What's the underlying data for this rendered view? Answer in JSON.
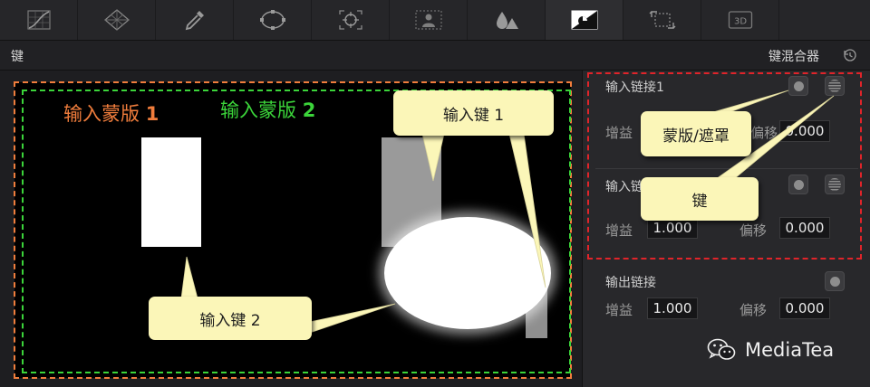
{
  "toolbar": {
    "tools": [
      {
        "icon": "curves-icon",
        "active": false
      },
      {
        "icon": "color-warper-icon",
        "active": false
      },
      {
        "icon": "qualifier-eyedropper-icon",
        "active": false
      },
      {
        "icon": "power-window-icon",
        "active": false
      },
      {
        "icon": "tracker-icon",
        "active": false
      },
      {
        "icon": "magic-mask-icon",
        "active": false
      },
      {
        "icon": "blur-icon",
        "active": false
      },
      {
        "icon": "key-icon",
        "active": true
      },
      {
        "icon": "sizing-icon",
        "active": false
      },
      {
        "icon": "3d-icon",
        "active": false,
        "label": "3D"
      }
    ]
  },
  "header": {
    "title": "键",
    "mode": "键混合器"
  },
  "viewer": {
    "matte1_label": "输入蒙版",
    "matte1_num": "1",
    "matte2_label": "输入蒙版",
    "matte2_num": "2",
    "callout_key1": "输入键 1",
    "callout_key2": "输入键 2",
    "colors": {
      "matte1": "#f07d3c",
      "matte2": "#3bd43a",
      "callout_bg": "#fbf6b8"
    }
  },
  "panel": {
    "link1": {
      "label": "输入链接1",
      "gain_label": "增益",
      "offset_label": "偏移",
      "offset_value": "0.000"
    },
    "link2": {
      "label": "输入链",
      "gain_label": "增益",
      "gain_value": "1.000",
      "offset_label": "偏移",
      "offset_value": "0.000"
    },
    "output": {
      "label": "输出链接",
      "gain_label": "增益",
      "gain_value": "1.000",
      "offset_label": "偏移",
      "offset_value": "0.000"
    },
    "callout_mask": "蒙版/遮罩",
    "callout_key": "键",
    "highlight_color": "#e0242a"
  },
  "watermark": {
    "brand": "MediaTea"
  }
}
